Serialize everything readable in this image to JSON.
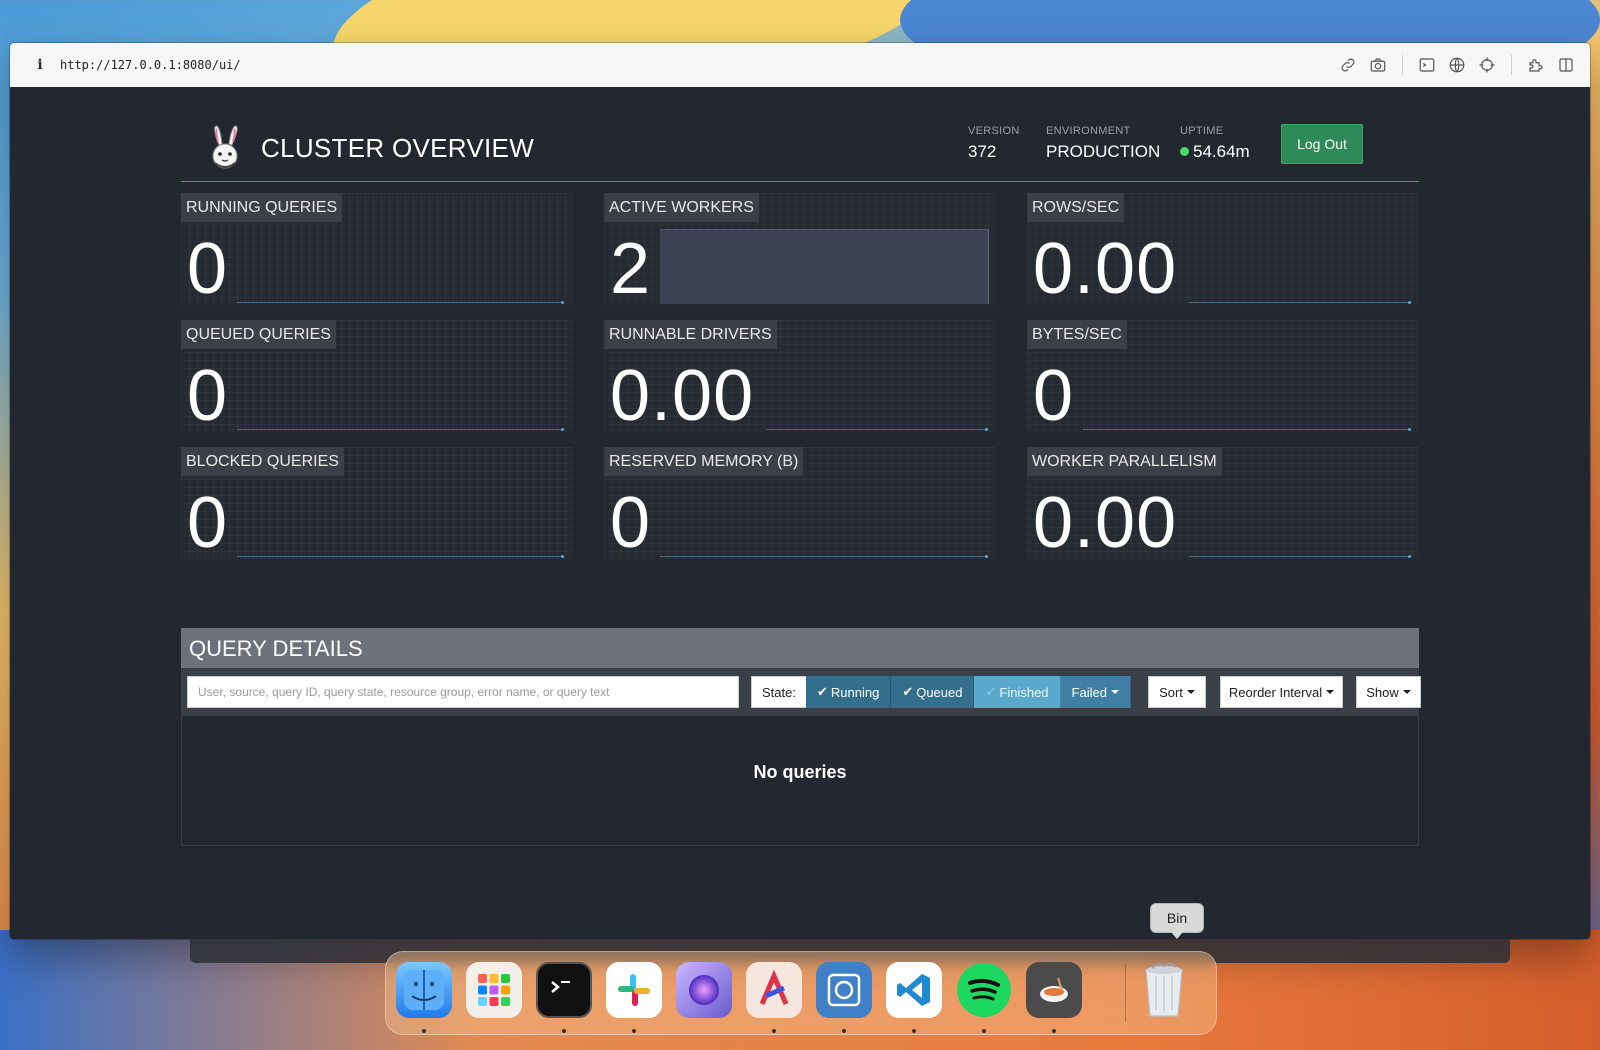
{
  "browser": {
    "info_icon": "i",
    "url": "http://127.0.0.1:8080/ui/",
    "toolbar_icons": [
      "link-icon",
      "camera-icon",
      "terminal-icon",
      "globe-icon",
      "crosshair-icon",
      "puzzle-icon",
      "sidebar-icon"
    ]
  },
  "header": {
    "title": "CLUSTER OVERVIEW",
    "version_label": "VERSION",
    "version": "372",
    "environment_label": "ENVIRONMENT",
    "environment": "PRODUCTION",
    "uptime_label": "UPTIME",
    "uptime": "54.64m",
    "uptime_status_color": "#4cd964",
    "logout_label": "Log Out"
  },
  "metrics": [
    {
      "label": "RUNNING QUERIES",
      "value": "0"
    },
    {
      "label": "ACTIVE WORKERS",
      "value": "2"
    },
    {
      "label": "ROWS/SEC",
      "value": "0.00"
    },
    {
      "label": "QUEUED QUERIES",
      "value": "0"
    },
    {
      "label": "RUNNABLE DRIVERS",
      "value": "0.00"
    },
    {
      "label": "BYTES/SEC",
      "value": "0"
    },
    {
      "label": "BLOCKED QUERIES",
      "value": "0"
    },
    {
      "label": "RESERVED MEMORY (B)",
      "value": "0"
    },
    {
      "label": "WORKER PARALLELISM",
      "value": "0.00"
    }
  ],
  "query_details": {
    "title": "QUERY DETAILS",
    "search_placeholder": "User, source, query ID, query state, resource group, error name, or query text",
    "state_label": "State:",
    "state_buttons": {
      "running": "Running",
      "queued": "Queued",
      "finished": "Finished",
      "failed": "Failed"
    },
    "sort_label": "Sort",
    "reorder_label": "Reorder Interval",
    "show_label": "Show",
    "empty_message": "No queries"
  },
  "dock": {
    "tooltip": "Bin",
    "apps": [
      "Finder",
      "Launchpad",
      "Terminal",
      "Slack",
      "Siri",
      "Affinity",
      "Screenshot",
      "Visual Studio Code",
      "Spotify",
      "Ramen",
      "Bin"
    ]
  },
  "colors": {
    "page_bg": "#232730",
    "accent_line": "#3a8fb7",
    "logout_green": "#2e8b57",
    "state_running": "#336f8c",
    "state_finished": "#5aa8cc"
  }
}
